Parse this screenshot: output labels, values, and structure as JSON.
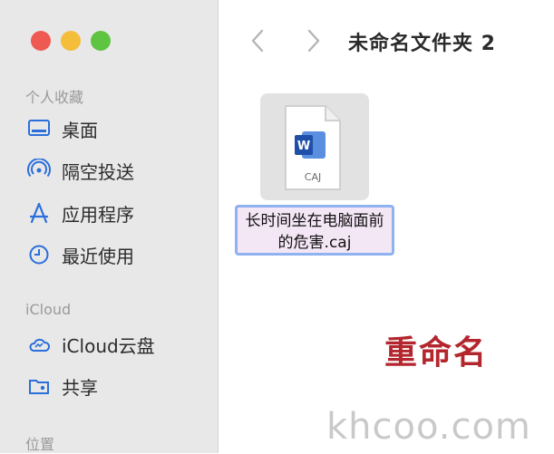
{
  "window": {
    "title": "未命名文件夹 2"
  },
  "sidebar": {
    "favorites_header": "个人收藏",
    "favorites": [
      {
        "label": "桌面",
        "icon": "desktop-icon"
      },
      {
        "label": "隔空投送",
        "icon": "airdrop-icon"
      },
      {
        "label": "应用程序",
        "icon": "applications-icon"
      },
      {
        "label": "最近使用",
        "icon": "recents-clock-icon"
      }
    ],
    "icloud_header": "iCloud",
    "icloud": [
      {
        "label": "iCloud云盘",
        "icon": "icloud-drive-icon"
      },
      {
        "label": "共享",
        "icon": "shared-folder-icon"
      }
    ],
    "locations_header": "位置"
  },
  "file": {
    "name": "长时间坐在电脑面前的危害.caj",
    "type_label": "CAJ",
    "icon": "word-document-icon"
  },
  "annotation": "重命名",
  "watermark": "khcoo.com",
  "colors": {
    "sidebar_bg": "#e9e8e8",
    "selection_border": "#8fb2f0",
    "annotation_red": "#b3262d",
    "accent_blue": "#2a6fdb"
  }
}
